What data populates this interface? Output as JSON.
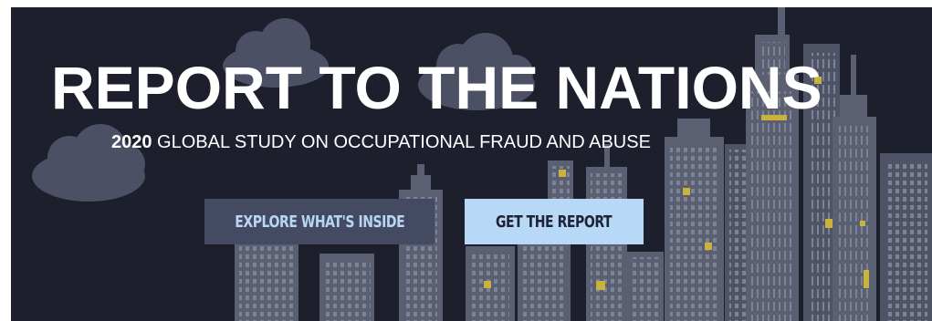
{
  "hero": {
    "title": "REPORT TO THE NATIONS",
    "subtitle_year": "2020",
    "subtitle_text": " GLOBAL STUDY ON OCCUPATIONAL FRAUD AND ABUSE"
  },
  "buttons": {
    "explore_label": "EXPLORE WHAT'S INSIDE",
    "report_label": "GET THE REPORT"
  },
  "colors": {
    "background": "#1d1f2c",
    "buildings": "#5a6072",
    "windows_accent": "#c8b43c",
    "cloud": "#4b5064",
    "explore_button": "#454a63",
    "report_button": "#b7d8f6"
  },
  "illustration": {
    "icons": [
      "cloud-icon",
      "building-icon"
    ]
  }
}
